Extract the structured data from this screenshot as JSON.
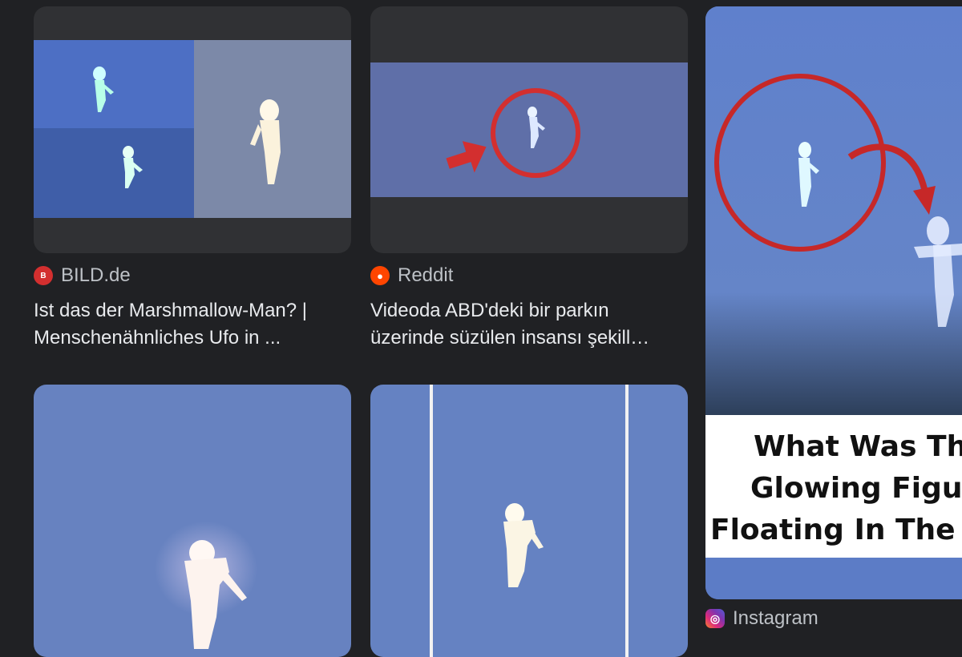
{
  "results": [
    {
      "source": "BILD.de",
      "source_icon": "bild-logo-icon",
      "title_line1": "Ist das der Marshmallow-Man? |",
      "title_line2": "Menschenähnliches Ufo in ..."
    },
    {
      "source": "Reddit",
      "source_icon": "reddit-logo-icon",
      "title_line1": "Videoda ABD'deki bir parkın",
      "title_line2": "üzerinde süzülen insansı şekill…"
    },
    {
      "source": "Instagram",
      "source_icon": "instagram-logo-icon",
      "overlay_text_line1": "What Was Thi",
      "overlay_text_line2": "Glowing Figur",
      "overlay_text_line3": "Floating In The S"
    }
  ],
  "colors": {
    "page_background": "#202124",
    "thumbnail_background": "#303134",
    "sky_blue": "#5b78b8",
    "highlight_red": "#d32f2f",
    "text_primary": "#e8eaed",
    "text_secondary": "#bdc1c6"
  }
}
